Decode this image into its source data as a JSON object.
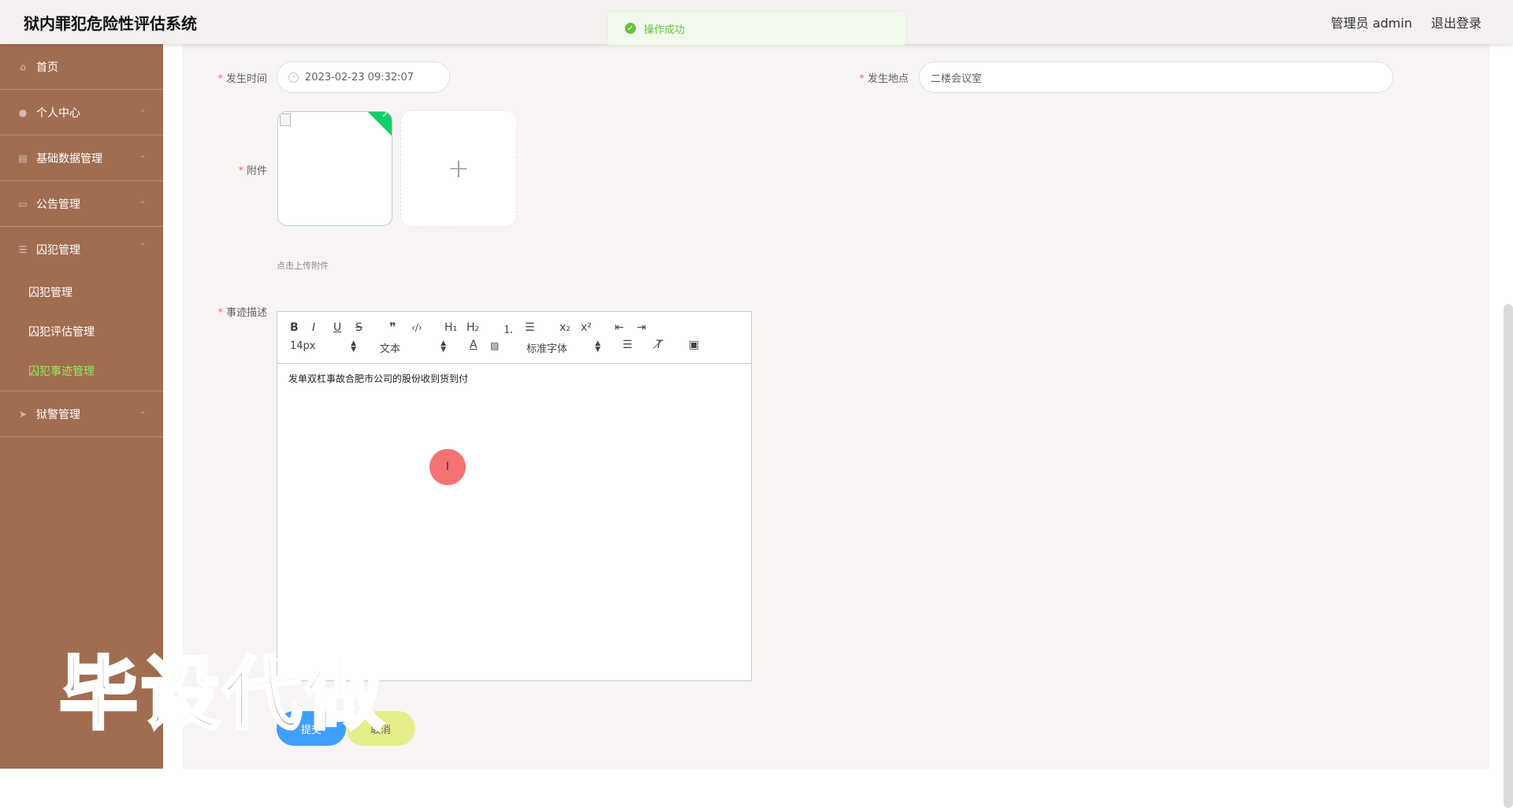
{
  "app": {
    "title": "狱内罪犯危险性评估系统"
  },
  "header": {
    "user_label": "管理员 admin",
    "logout_label": "退出登录"
  },
  "toast": {
    "message": "操作成功",
    "type": "success",
    "icon": "check-circle-icon"
  },
  "sidebar": {
    "items": [
      {
        "label": "首页",
        "icon": "home-icon"
      },
      {
        "label": "个人中心",
        "icon": "user-icon"
      },
      {
        "label": "基础数据管理",
        "icon": "database-icon"
      },
      {
        "label": "公告管理",
        "icon": "monitor-icon"
      },
      {
        "label": "囚犯管理",
        "icon": "list-icon",
        "expanded": true,
        "children": [
          {
            "label": "囚犯管理"
          },
          {
            "label": "囚犯评估管理"
          },
          {
            "label": "囚犯事迹管理",
            "active": true
          }
        ]
      },
      {
        "label": "狱警管理",
        "icon": "send-icon"
      }
    ]
  },
  "form": {
    "time_label": "发生时间",
    "time_value": "2023-02-23 09:32:07",
    "location_label": "发生地点",
    "location_value": "二楼会议室",
    "attachment_label": "附件",
    "attachment_hint": "点击上传附件",
    "description_label": "事迹描述",
    "description_value": "发单双杠事故合肥市公司的股份收到货到付"
  },
  "editor_toolbar": {
    "bold": "B",
    "italic": "I",
    "underline": "U",
    "strike": "S",
    "quote": "❞",
    "code": "‹/›",
    "h1": "H₁",
    "h2": "H₂",
    "size_value": "14px",
    "header_value": "文本",
    "font_value": "标准字体",
    "subscript": "x₂",
    "superscript": "x²"
  },
  "buttons": {
    "submit": "提交",
    "cancel": "取消"
  },
  "watermark": "毕设代做",
  "colors": {
    "sidebar": "#a16d51",
    "active_menu": "#8cf05a",
    "submit": "#409eff",
    "cancel": "#e5ee8a",
    "success": "#67c23a"
  }
}
